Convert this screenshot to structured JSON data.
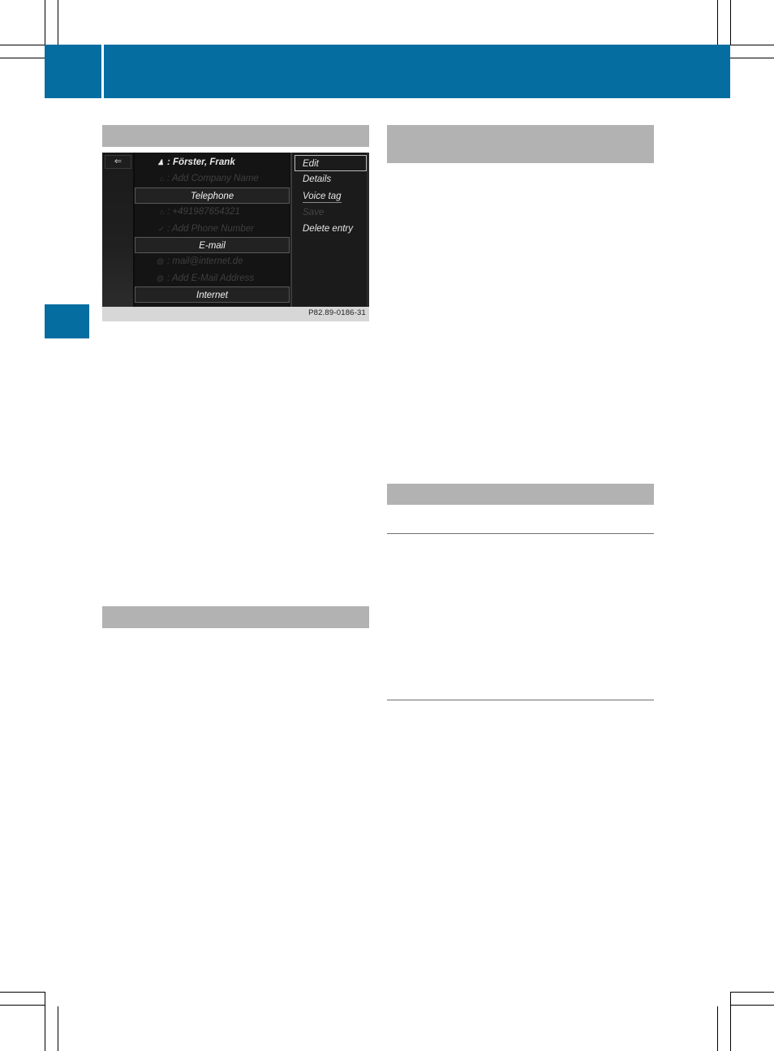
{
  "screen": {
    "back_icon": "back-arrow-icon",
    "list_rows": [
      {
        "icon": "♟",
        "text": ": Förster, Frank",
        "style": "selected"
      },
      {
        "icon": "⌂",
        "text": ": Add Company Name",
        "style": "dim"
      },
      {
        "text": "Telephone",
        "style": "header"
      },
      {
        "icon": "⌂",
        "text": ": +491987654321",
        "style": "dim"
      },
      {
        "icon": "✓",
        "text": ": Add Phone Number",
        "style": "dim"
      },
      {
        "text": "E-mail",
        "style": "header"
      },
      {
        "icon": "@",
        "text": ": mail@internet.de",
        "style": "dim"
      },
      {
        "icon": "@",
        "text": ": Add E-Mail Address",
        "style": "dim"
      },
      {
        "text": "Internet",
        "style": "header"
      }
    ],
    "menu": [
      {
        "label": "Edit",
        "state": "active"
      },
      {
        "label": "Details",
        "state": "normal"
      },
      {
        "label": "Voice tag",
        "state": "underline"
      },
      {
        "label": "Save",
        "state": "disabled"
      },
      {
        "label": "Delete entry",
        "state": "normal"
      }
    ],
    "caption": "P82.89-0186-31"
  },
  "colors": {
    "brand_blue": "#056da0",
    "section_gray": "#b2b2b2"
  }
}
